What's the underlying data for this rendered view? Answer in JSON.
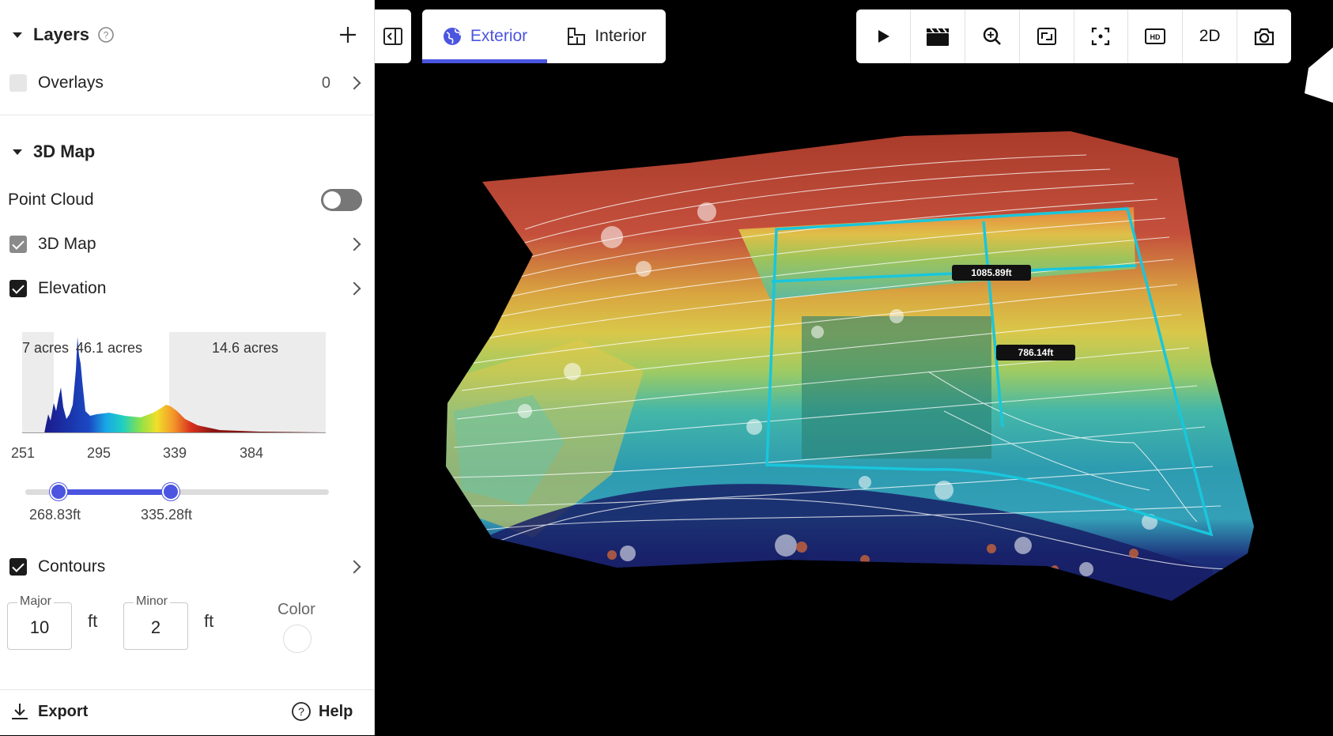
{
  "layers": {
    "title": "Layers",
    "overlays_label": "Overlays",
    "overlays_count": "0"
  },
  "map3d": {
    "title": "3D Map",
    "point_cloud_label": "Point Cloud",
    "point_cloud_on": false,
    "map_label": "3D Map",
    "elevation_label": "Elevation",
    "histogram": {
      "area_labels": [
        "7 acres",
        "46.1 acres",
        "14.6 acres"
      ],
      "axis_ticks": [
        "251",
        "295",
        "339",
        "384"
      ],
      "range_low": "268.83ft",
      "range_high": "335.28ft"
    },
    "contours_label": "Contours",
    "major_label": "Major",
    "major_value": "10",
    "minor_label": "Minor",
    "minor_value": "2",
    "unit": "ft",
    "color_label": "Color"
  },
  "footer": {
    "export_label": "Export",
    "help_label": "Help"
  },
  "tabs": {
    "exterior": "Exterior",
    "interior": "Interior",
    "active": "exterior"
  },
  "toolbar": {
    "mode_2d": "2D"
  },
  "measurements": {
    "width": "1085.89ft",
    "height": "786.14ft"
  },
  "colors": {
    "accent": "#4b55e0",
    "measure_line": "#19c6dc"
  }
}
